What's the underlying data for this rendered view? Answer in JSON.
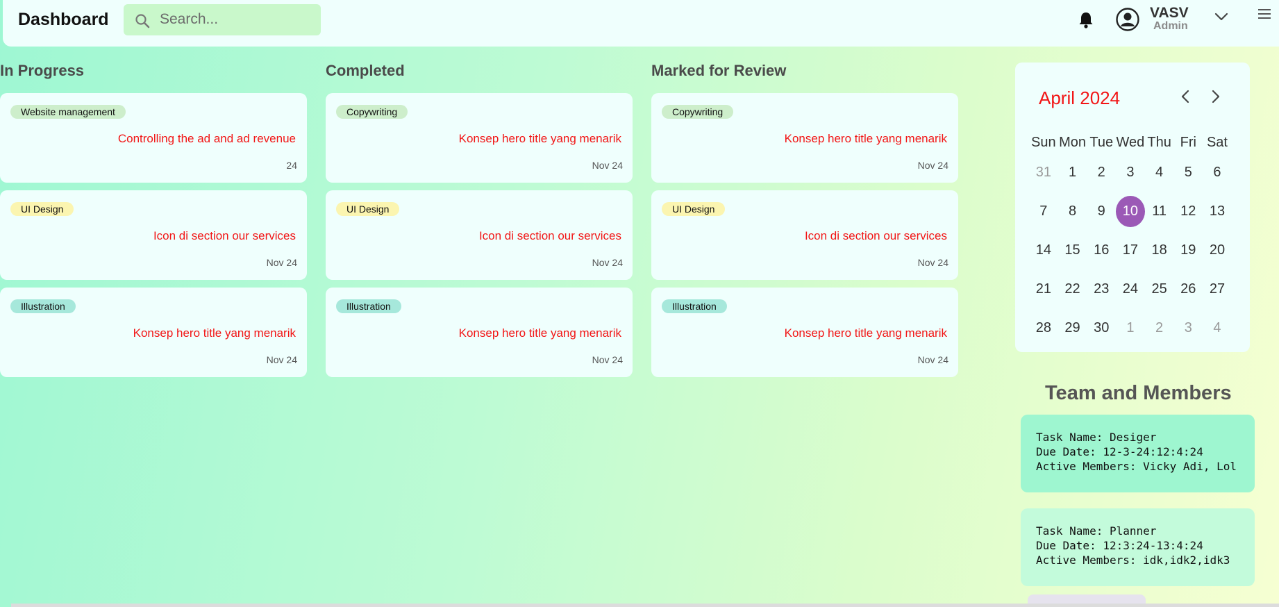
{
  "header": {
    "title": "Dashboard",
    "search_placeholder": "Search...",
    "user_name": "VASV",
    "user_role": "Admin"
  },
  "columns": [
    {
      "title": "In Progress",
      "cards": [
        {
          "tag": "Website management",
          "tag_color": "#cdeecb",
          "title": "Controlling the ad and ad revenue",
          "date": "24"
        },
        {
          "tag": "UI Design",
          "tag_color": "#fbf5b0",
          "title": "Icon di section our services",
          "date": "Nov 24"
        },
        {
          "tag": "Illustration",
          "tag_color": "#a6e8db",
          "title": "Konsep hero title yang menarik",
          "date": "Nov 24"
        }
      ]
    },
    {
      "title": "Completed",
      "cards": [
        {
          "tag": "Copywriting",
          "tag_color": "#cdeecb",
          "title": "Konsep hero title yang menarik",
          "date": "Nov 24"
        },
        {
          "tag": "UI Design",
          "tag_color": "#fbf5b0",
          "title": "Icon di section our services",
          "date": "Nov 24"
        },
        {
          "tag": "Illustration",
          "tag_color": "#a6e8db",
          "title": "Konsep hero title yang menarik",
          "date": "Nov 24"
        }
      ]
    },
    {
      "title": "Marked for Review",
      "cards": [
        {
          "tag": "Copywriting",
          "tag_color": "#cdeecb",
          "title": "Konsep hero title yang menarik",
          "date": "Nov 24"
        },
        {
          "tag": "UI Design",
          "tag_color": "#fbf5b0",
          "title": "Icon di section our services",
          "date": "Nov 24"
        },
        {
          "tag": "Illustration",
          "tag_color": "#a6e8db",
          "title": "Konsep hero title yang menarik",
          "date": "Nov 24"
        }
      ]
    }
  ],
  "calendar": {
    "month_label": "April 2024",
    "weekdays": [
      "Sun",
      "Mon",
      "Tue",
      "Wed",
      "Thu",
      "Fri",
      "Sat"
    ],
    "weeks": [
      [
        {
          "d": "31",
          "m": true
        },
        {
          "d": "1"
        },
        {
          "d": "2"
        },
        {
          "d": "3"
        },
        {
          "d": "4"
        },
        {
          "d": "5"
        },
        {
          "d": "6"
        }
      ],
      [
        {
          "d": "7"
        },
        {
          "d": "8"
        },
        {
          "d": "9"
        },
        {
          "d": "10",
          "sel": true
        },
        {
          "d": "11"
        },
        {
          "d": "12"
        },
        {
          "d": "13"
        }
      ],
      [
        {
          "d": "14"
        },
        {
          "d": "15"
        },
        {
          "d": "16"
        },
        {
          "d": "17"
        },
        {
          "d": "18"
        },
        {
          "d": "19"
        },
        {
          "d": "20"
        }
      ],
      [
        {
          "d": "21"
        },
        {
          "d": "22"
        },
        {
          "d": "23"
        },
        {
          "d": "24"
        },
        {
          "d": "25"
        },
        {
          "d": "26"
        },
        {
          "d": "27"
        }
      ],
      [
        {
          "d": "28"
        },
        {
          "d": "29"
        },
        {
          "d": "30"
        },
        {
          "d": "1",
          "m": true
        },
        {
          "d": "2",
          "m": true
        },
        {
          "d": "3",
          "m": true
        },
        {
          "d": "4",
          "m": true
        }
      ]
    ],
    "selected_color": "#9b59b6"
  },
  "team": {
    "title": "Team and Members",
    "items": [
      {
        "task": "Task Name: Desiger",
        "due": "Due Date: 12-3-24:12:4:24",
        "members": "Active Members: Vicky Adi, Lol",
        "bg": "#9ef6d0"
      },
      {
        "task": "Task Name: Planner",
        "due": "Due Date: 12:3:24-13:4:24",
        "members": "Active Members: idk,idk2,idk3",
        "bg": "#c3fbdb"
      }
    ]
  },
  "icons": {
    "search": "search-icon",
    "bell": "bell-icon",
    "avatar": "user-circle-icon",
    "chevron": "chevron-down-icon",
    "menu": "hamburger-menu-icon"
  }
}
